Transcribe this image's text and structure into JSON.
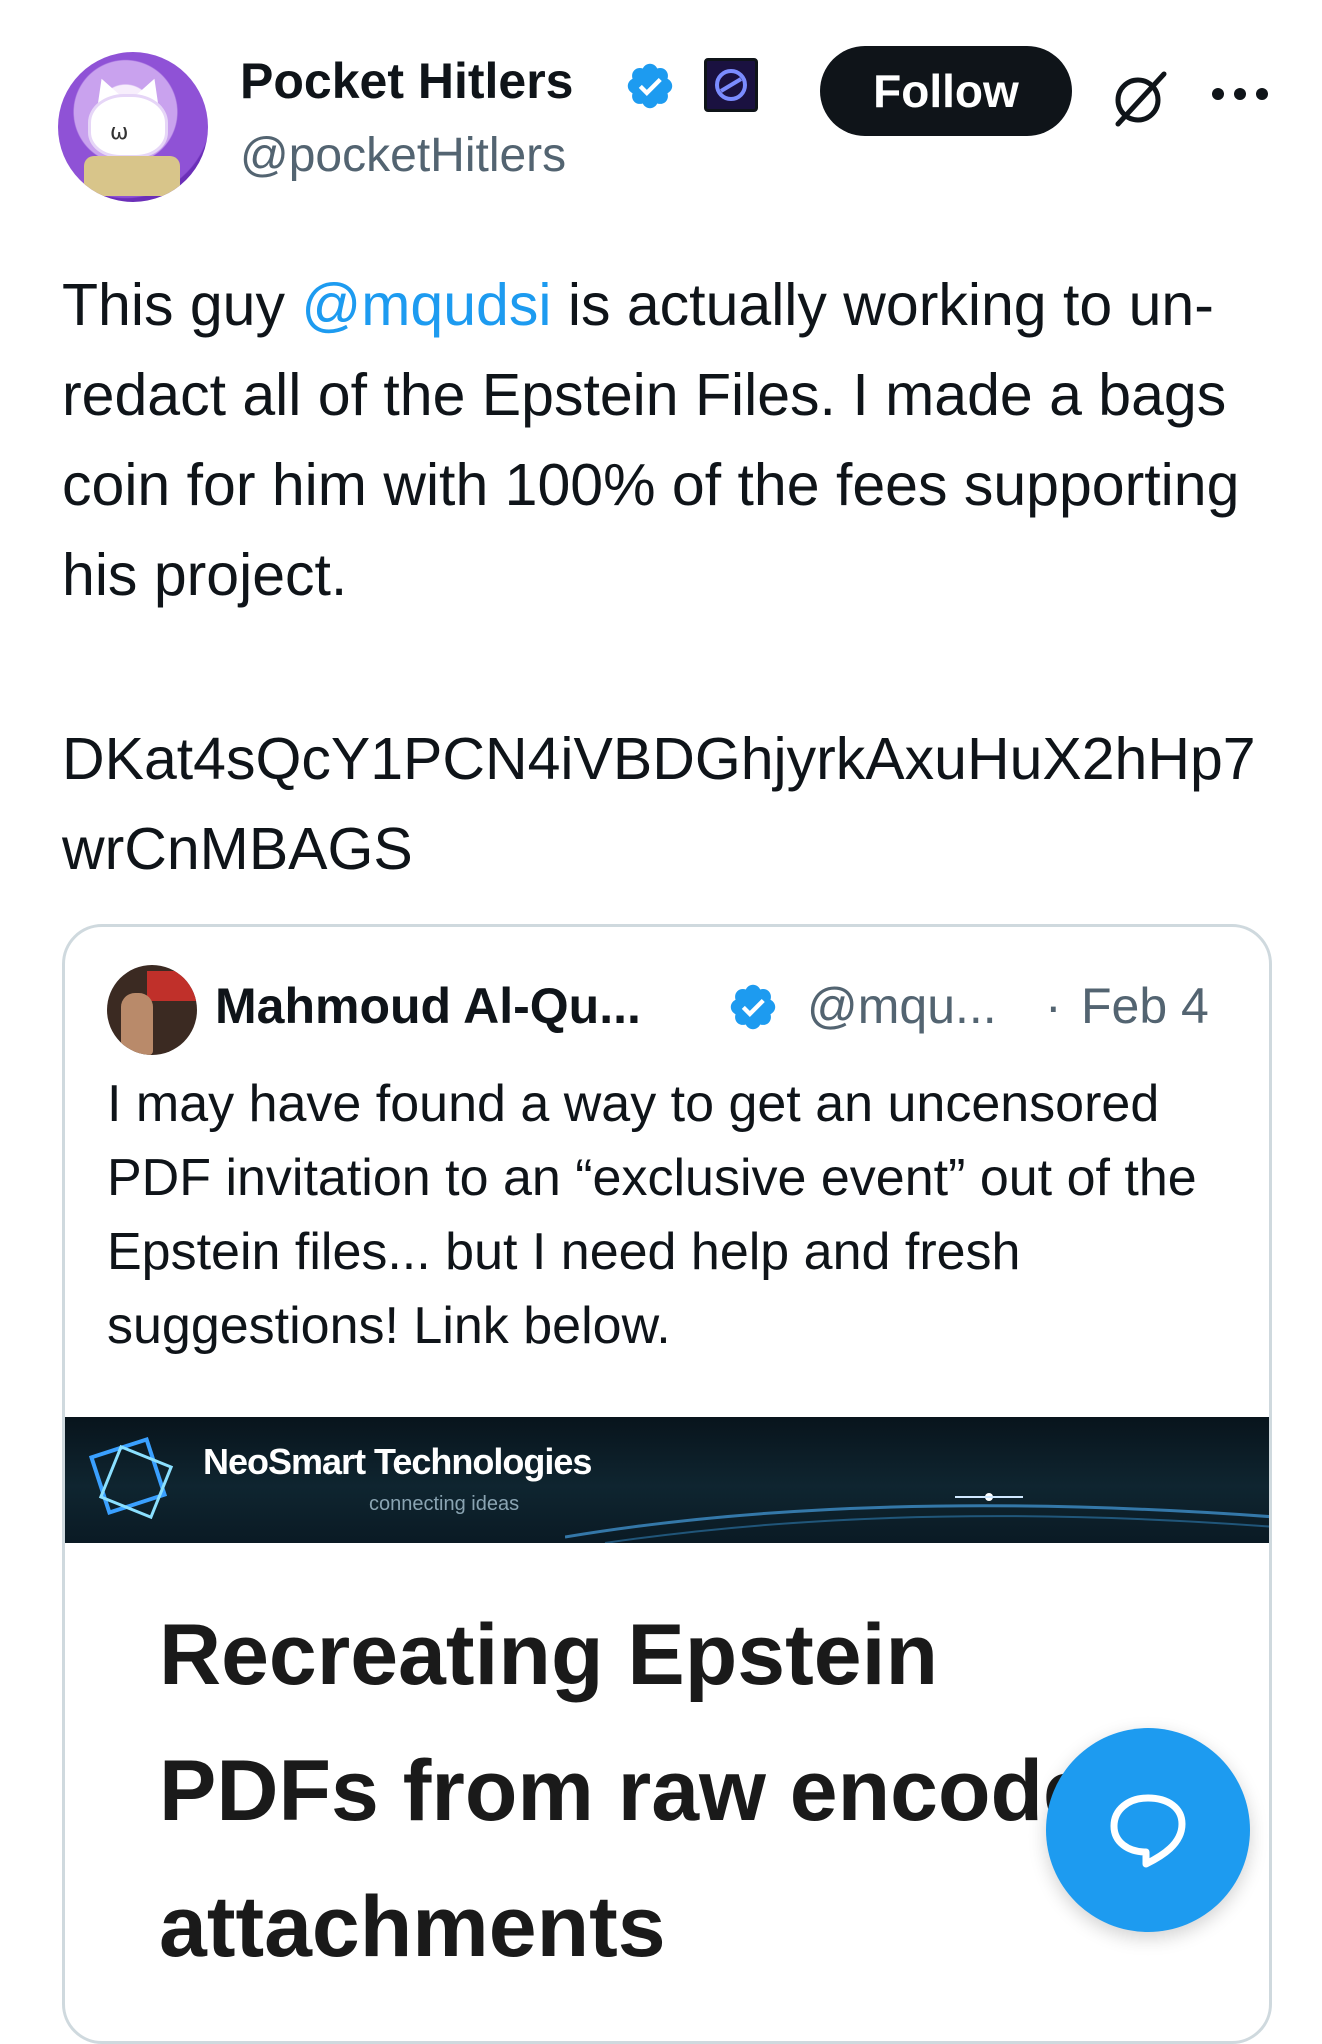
{
  "author": {
    "display_name": "Pocket Hitlers",
    "handle": "@pocketHitlers"
  },
  "header": {
    "follow_label": "Follow"
  },
  "tweet": {
    "text_before_mention": "This guy ",
    "mention": "@mqudsi",
    "text_after_mention": " is actually working to un-redact all of the Epstein Files. I made a bags coin for him with 100% of the fees supporting his project.",
    "contract_address": "DKat4sQcY1PCN4iVBDGhjyrkAxuHuX2hHp7wrCnMBAGS"
  },
  "quote": {
    "display_name": "Mahmoud Al-Qu...",
    "handle": "@mqu...",
    "separator": "·",
    "date": "Feb 4",
    "text": "I may have found a way to get an uncensored PDF invitation to an “exclusive event” out of the Epstein files... but I need help and fresh suggestions! Link below.",
    "card": {
      "brand_title": "NeoSmart Technologies",
      "brand_tagline": "connecting ideas",
      "article_title": "Recreating Epstein PDFs from raw encoded attachments"
    }
  },
  "colors": {
    "accent": "#1d9bf0",
    "text_primary": "#0f1419",
    "text_secondary": "#536471",
    "border": "#cfd9de",
    "follow_bg": "#0f1419"
  },
  "icons": {
    "verified": "verified-badge-icon",
    "organization": "organization-badge-icon",
    "grok": "grok-icon",
    "more": "more-options-icon",
    "reply_fab": "reply-bubble-icon"
  }
}
